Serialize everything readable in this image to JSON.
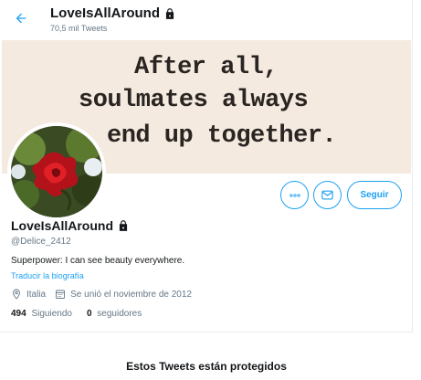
{
  "header": {
    "name": "LoveIsAllAround",
    "tweet_count": "70,5 mil Tweets"
  },
  "banner": {
    "line1": "After all,",
    "line2": "soulmates always",
    "line3": "end up together."
  },
  "profile": {
    "name": "LoveIsAllAround",
    "handle": "@Delice_2412",
    "bio": "Superpower: I can see beauty everywhere.",
    "translate_label": "Traducir la biografía",
    "location": "Italia",
    "joined": "Se unió el noviembre de 2012",
    "following_count": "494",
    "following_label": "Siguiendo",
    "followers_count": "0",
    "followers_label": "seguidores"
  },
  "actions": {
    "follow_label": "Seguir"
  },
  "protected_notice": "Estos Tweets están protegidos",
  "icons": {
    "back": "arrow-left-icon",
    "lock": "lock-icon",
    "more": "more-icon",
    "message": "envelope-icon",
    "location": "location-pin-icon",
    "calendar": "calendar-icon"
  },
  "colors": {
    "accent": "#1da1f2",
    "muted": "#657786",
    "text": "#14171a"
  }
}
